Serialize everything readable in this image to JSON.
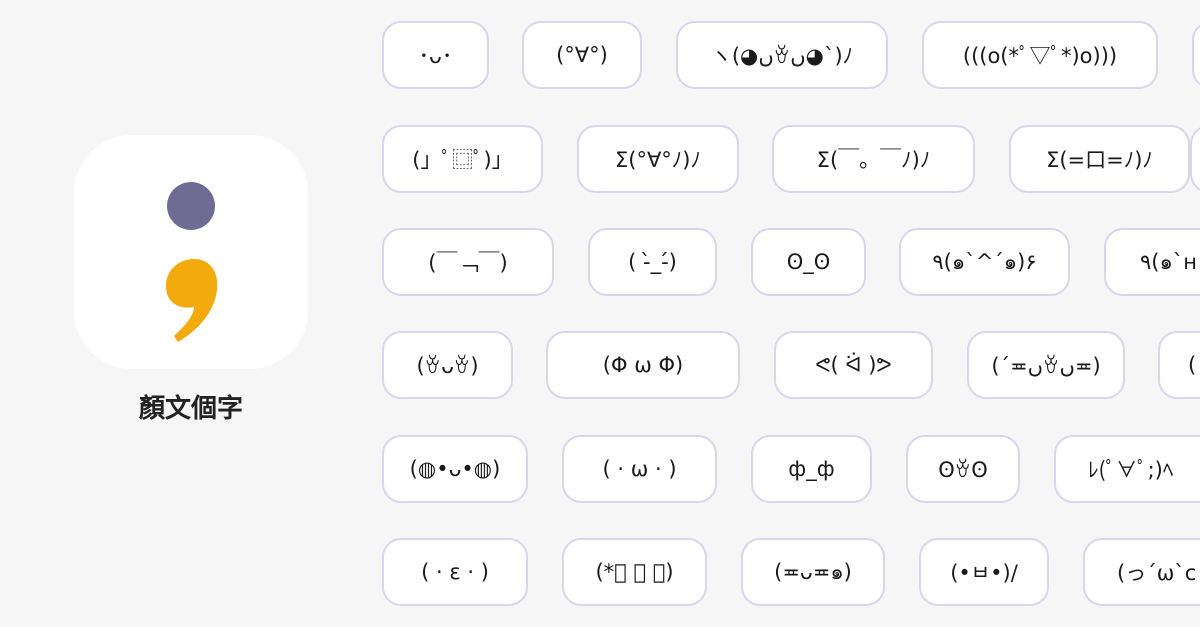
{
  "app": {
    "name": "顏文個字",
    "icon": "semicolon-icon",
    "colors": {
      "dot": "#6e6b95",
      "comma": "#f2aa0d"
    }
  },
  "kaomoji": [
    [
      "･ᴗ･",
      "(°∀°)",
      "ヽ(◕ںꈊں◕`)ﾉ",
      "(((o(*ﾟ▽ﾟ*)o)))",
      ""
    ],
    [
      "(」ﾟ⿴ﾟ)」",
      "Σ(°∀°ﾉ)ﾉ",
      "Σ(￣。￣ﾉ)ﾉ",
      "Σ(=口=ﾉ)ﾉ",
      ""
    ],
    [
      "(￣﹁￣)",
      "( -̀_-́)",
      "ʘ_ʘ",
      "٩(๑`^´๑)۶",
      "٩(๑`ʜ"
    ],
    [
      "(ꈊᴗꈊ)",
      "(Φ ω Φ)",
      "ᕙ( ᐛ )ᕗ",
      "(´≖ںꈊں≖)",
      "("
    ],
    [
      "(◍•ᴗ•◍)",
      "( · ω · )",
      "ф_ф",
      "ʘꈊʘ",
      "ﾚ(ﾟ∀ﾟ;)ﾍ"
    ],
    [
      "( · ε · )",
      "(*ﾟ ー ﾟ)",
      "(≖ᴗ≖๑)",
      "(•ㅂ•)/",
      "(っ´ω`c"
    ]
  ]
}
